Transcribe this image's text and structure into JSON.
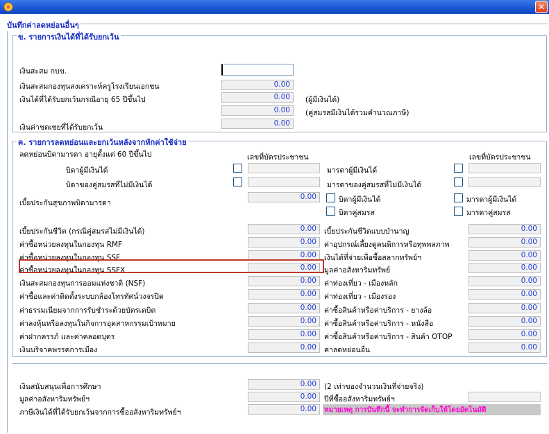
{
  "window": {
    "close_glyph": "✕"
  },
  "dialog_title": "บันทึกค่าลดหย่อนอื่นๆ",
  "sec_b": {
    "title": "ข. รายการเงินได้ที่ได้รับยกเว้น",
    "gpf": "เงินสะสม กบข.",
    "private_teacher": "เงินสะสมกองทุนสงเคราะห์ครูโรงเรียนเอกชน",
    "private_teacher_val": "0.00",
    "age65": "เงินได้ที่ได้รับยกเว้นกรณีอายุ 65 ปีขึ้นไป",
    "age65_val": "0.00",
    "age65_note": "(ผู้มีเงินได้)",
    "age65_spouse_val": "0.00",
    "age65_spouse_note": "(คู่สมรสมีเงินได้รวมคำนวณภาษี)",
    "compensation": "เงินค่าชดเชยที่ได้รับยกเว้น",
    "compensation_val": "0.00"
  },
  "sec_k": {
    "title": "ค. รายการลดหย่อนและยกเว้นหลังจากหักค่าใช้จ่าย",
    "parents": "ลดหย่อนบิดามารดา อายุตั้งแต่ 60 ปีขึ้นไป",
    "id_header": "เลขที่บัตรประชาชน",
    "id_header_right": "เลขที่บัตรประชาชน",
    "father": "บิดาผู้มีเงินได้",
    "spouse_father": "บิดาของคู่สมรสที่ไม่มีเงินได้",
    "mother": "มารดาผู้มีเงินได้",
    "spouse_mother": "มารดาของคู่สมรสที่ไม่มีเงินได้",
    "parent_health": "เบี้ยประกันสุขภาพบิดามารดา",
    "parent_health_val": "0.00",
    "chk_father": "บิดาผู้มีเงินได้",
    "chk_mother": "มารดาผู้มีเงินได้",
    "chk_spouse_father": "บิดาคู่สมรส",
    "chk_spouse_mother": "มารดาคู่สมรส",
    "left_rows": [
      {
        "label": "เบี้ยประกันชีวิต (กรณีคู่สมรสไม่มีเงินได้)",
        "value": "0.00"
      },
      {
        "label": "ค่าซื้อหน่วยลงทุนในกองทุน RMF",
        "value": "0.00"
      },
      {
        "label": "ค่าซื้อหน่วยลงทุนในกองทุน SSF",
        "value": "0.00"
      },
      {
        "label": "ค่าซื้อหน่วยลงทุนในกองทุน SSFX",
        "value": "0.00"
      },
      {
        "label": "เงินสะสมกองทุนการออมแห่งชาติ (NSF)",
        "value": "0.00"
      },
      {
        "label": "ค่าซื้อและค่าติดตั้งระบบกล้องโทรทัศน์วงจรปิด",
        "value": "0.00"
      },
      {
        "label": "ค่าธรรมเนียมจากการรับชำระด้วยบัตรเดบิต",
        "value": "0.00"
      },
      {
        "label": "ค่าลงหุ้นหรือลงทุนในกิจการอุตสาหกรรมเป้าหมาย",
        "value": "0.00"
      },
      {
        "label": "ค่าฝากครรภ์ และค่าคลอดบุตร",
        "value": "0.00"
      },
      {
        "label": "เงินบริจาคพรรคการเมือง",
        "value": "0.00"
      }
    ],
    "right_rows": [
      {
        "label": "เบี้ยประกันชีวิตแบบบำนาญ",
        "value": "0.00"
      },
      {
        "label": "ค่าอุปกรณ์เลี้ยงดูคนพิการหรือทุพพลภาพ",
        "value": "0.00"
      },
      {
        "label": "เงินได้ที่จ่ายเพื่อซื้อสลากทรัพย์ฯ",
        "value": "0.00"
      },
      {
        "label": "มูลค่าอสังหาริมทรัพย์",
        "value": "0.00"
      },
      {
        "label": "ค่าท่องเที่ยว - เมืองหลัก",
        "value": "0.00"
      },
      {
        "label": "ค่าท่องเที่ยว - เมืองรอง",
        "value": "0.00"
      },
      {
        "label": "ค่าซื้อสินค้าหรือค่าบริการ - ยางล้อ",
        "value": "0.00"
      },
      {
        "label": "ค่าซื้อสินค้าหรือค่าบริการ - หนังสือ",
        "value": "0.00"
      },
      {
        "label": "ค่าซื้อสินค้าหรือค่าบริการ - สินค้า OTOP",
        "value": "0.00"
      },
      {
        "label": "ค่าลดหย่อนอื่น",
        "value": "0.00"
      }
    ]
  },
  "bottom": {
    "education": "เงินสนับสนุนเพื่อการศึกษา",
    "education_val": "0.00",
    "education_note": "(2 เท่าของจำนวนเงินที่จ่ายจริง)",
    "property_value": "มูลค่าอสังหาริมทรัพย์ฯ",
    "property_value_val": "0.00",
    "property_year": "ปีที่ซื้ออสังหาริมทรัพย์ฯ",
    "property_exempt": "ภาษีเงินได้ที่ได้รับยกเว้นจากการซื้ออสังหาริมทรัพย์ฯ",
    "property_exempt_val": "0.00",
    "note": "หมายเหตุ การบันทึกนี้ จะทำการจัดเก็บให้โดยอัตโนมัติ"
  }
}
